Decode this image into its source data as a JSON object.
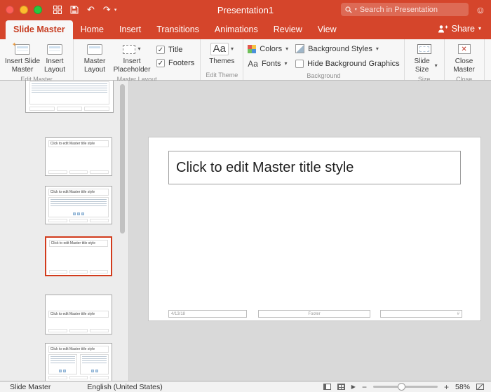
{
  "icons": {
    "chevron_down": "▾",
    "check": "✓",
    "star": "✦",
    "close_x": "✕",
    "smiley": "☺",
    "undo": "↶",
    "redo": "↷",
    "zoom_out": "−",
    "zoom_in": "+",
    "slideshow": "▶"
  },
  "titlebar": {
    "title": "Presentation1",
    "search_placeholder": "Search in Presentation"
  },
  "tabs": {
    "items": [
      "Slide Master",
      "Home",
      "Insert",
      "Transitions",
      "Animations",
      "Review",
      "View"
    ],
    "share_label": "Share"
  },
  "ribbon": {
    "edit_master": {
      "label": "Edit Master",
      "insert_slide_master": "Insert Slide Master",
      "insert_layout": "Insert Layout"
    },
    "master_layout": {
      "label": "Master Layout",
      "master_layout_btn": "Master Layout",
      "insert_placeholder": "Insert Placeholder",
      "title_checkbox": {
        "label": "Title",
        "mark": "✓"
      },
      "footers_checkbox": {
        "label": "Footers",
        "mark": "✓"
      }
    },
    "edit_theme": {
      "label": "Edit Theme",
      "themes": "Themes",
      "themes_glyph": "Aa"
    },
    "background": {
      "label": "Background",
      "colors_btn": "Colors",
      "fonts_btn": "Fonts",
      "fonts_glyph": "Aa",
      "background_styles": "Background Styles",
      "hide_checkbox": {
        "label": "Hide Background Graphics",
        "mark": ""
      }
    },
    "size": {
      "label": "Size",
      "slide_size": "Slide Size"
    },
    "close": {
      "label": "Close",
      "close_master": "Close Master"
    }
  },
  "thumbnails": {
    "title_text": "Click to edit Master title style"
  },
  "slide": {
    "title_placeholder": "Click to edit Master title style",
    "date_placeholder": "4/13/18",
    "footer_placeholder": "Footer",
    "number_placeholder": "#"
  },
  "statusbar": {
    "view": "Slide Master",
    "language": "English (United States)",
    "zoom": "58%"
  }
}
